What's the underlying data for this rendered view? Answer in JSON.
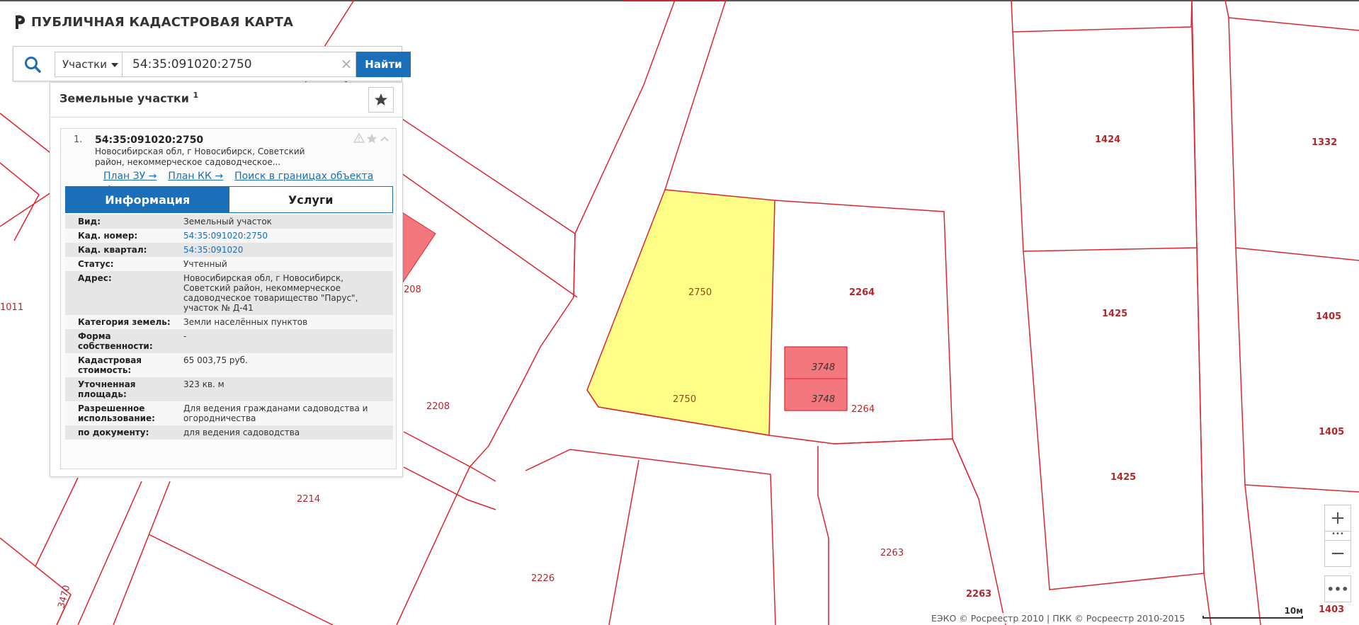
{
  "app": {
    "title": "ПУБЛИЧНАЯ КАДАСТРОВАЯ КАРТА"
  },
  "search": {
    "type_label": "Участки",
    "query": "54:35:091020:2750",
    "clear_symbol": "×",
    "button_label": "Найти"
  },
  "results": {
    "header": "Земельные участки",
    "count": "1",
    "item": {
      "index": "1.",
      "cad_number": "54:35:091020:2750",
      "address_short": "Новосибирская обл, г Новосибирск, Советский район, некоммерческое садоводческое...",
      "links": [
        "План ЗУ →",
        "План КК →",
        "Поиск в границах объекта →"
      ],
      "tabs": [
        "Информация",
        "Услуги"
      ],
      "fields": [
        {
          "key": "Вид:",
          "value": "Земельный участок"
        },
        {
          "key": "Кад. номер:",
          "value": "54:35:091020:2750",
          "link": true
        },
        {
          "key": "Кад. квартал:",
          "value": "54:35:091020",
          "link": true
        },
        {
          "key": "Статус:",
          "value": "Учтенный"
        },
        {
          "key": "Адрес:",
          "value": "Новосибирская обл, г Новосибирск, Советский район, некоммерческое садоводческое товарищество \"Парус\", участок № Д-41"
        },
        {
          "key": "Категория земель:",
          "value": "Земли населённых пунктов"
        },
        {
          "key": "Форма собственности:",
          "value": "-"
        },
        {
          "key": "Кадастровая стоимость:",
          "value": "65 003,75 руб."
        },
        {
          "key": "Уточненная площадь:",
          "value": "323 кв. м"
        },
        {
          "key": "Разрешенное использование:",
          "value": "Для ведения гражданами садоводства и огородничества"
        },
        {
          "key": "по документу:",
          "value": "для ведения садоводства"
        }
      ]
    }
  },
  "map": {
    "labels": {
      "p2750a": "2750",
      "p2750b": "2750",
      "p2264a": "2264",
      "p2264b": "2264",
      "p3748a": "3748",
      "p3748b": "3748",
      "p1424": "1424",
      "p1332": "1332",
      "p1425a": "1425",
      "p1425b": "1425",
      "p1405a": "1405",
      "p1405b": "1405",
      "p1403": "1403",
      "p2208a": "208",
      "p2208b": "2208",
      "p1011": "1011",
      "p2214": "2214",
      "p2226": "2226",
      "p2263a": "2263",
      "p2263b": "2263",
      "p3470": "3470"
    },
    "colors": {
      "boundary": "#e0242f",
      "selected_fill": "#ffff88",
      "highlight_fill": "#f4777d"
    }
  },
  "controls": {
    "zoom_in": "+",
    "zoom_dots": "•••",
    "zoom_out": "−",
    "more": "•••"
  },
  "footer": {
    "copyright": "ЕЭКО © Росреестр 2010 | ПКК © Росреестр 2010-2015",
    "scale_label": "10м"
  }
}
